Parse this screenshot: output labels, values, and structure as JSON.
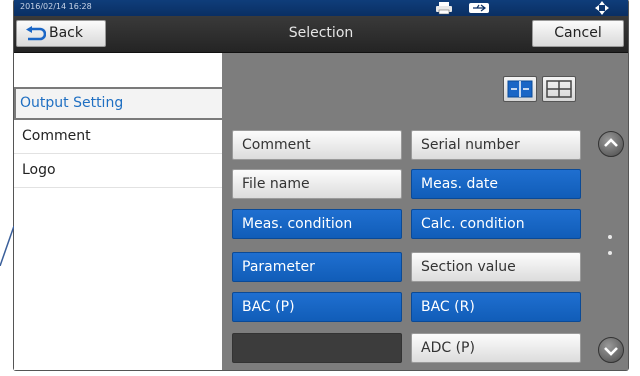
{
  "status_bar": {
    "datetime": "2016/02/14 16:28",
    "icons": [
      "printer-icon",
      "usb-icon",
      "navigation-pad-icon"
    ]
  },
  "title_bar": {
    "back_label": "Back",
    "title": "Selection",
    "cancel_label": "Cancel"
  },
  "sidebar": {
    "items": [
      {
        "label": "Output Setting",
        "selected": true
      },
      {
        "label": "Comment",
        "selected": false
      },
      {
        "label": "Logo",
        "selected": false
      }
    ]
  },
  "main": {
    "layout_toggle": [
      "two-column-layout-icon",
      "single-column-layout-icon"
    ],
    "items": [
      {
        "label": "Comment",
        "state": "off"
      },
      {
        "label": "Serial number",
        "state": "off"
      },
      {
        "label": "File name",
        "state": "off"
      },
      {
        "label": "Meas. date",
        "state": "on"
      },
      {
        "label": "Meas. condition",
        "state": "on"
      },
      {
        "label": "Calc. condition",
        "state": "on"
      },
      {
        "label": "Parameter",
        "state": "on"
      },
      {
        "label": "Section value",
        "state": "off"
      },
      {
        "label": "BAC (P)",
        "state": "on"
      },
      {
        "label": "BAC (R)",
        "state": "on"
      },
      {
        "label": "",
        "state": "disabled"
      },
      {
        "label": "ADC (P)",
        "state": "off"
      }
    ]
  },
  "colors": {
    "status_bar": "#0a2f63",
    "selected_blue": "#1a66c6",
    "sidebar_accent": "#1f6fc2",
    "panel_gray": "#7d7d7d"
  }
}
